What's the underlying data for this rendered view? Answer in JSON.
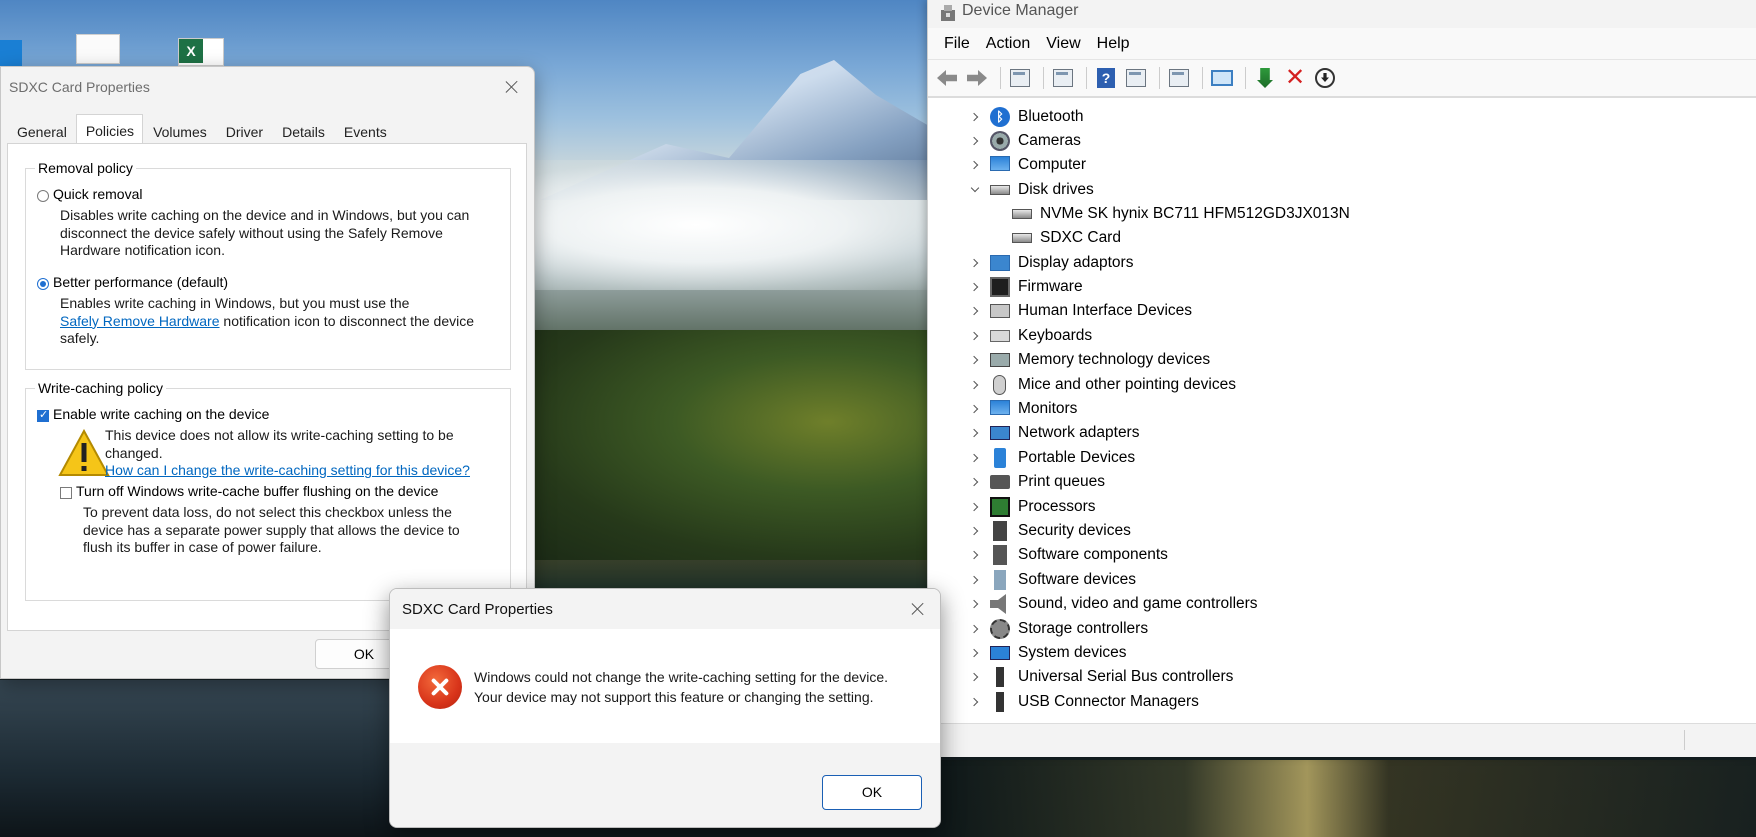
{
  "properties": {
    "title": "SDXC Card Properties",
    "tabs": [
      "General",
      "Policies",
      "Volumes",
      "Driver",
      "Details",
      "Events"
    ],
    "removal_policy": {
      "legend": "Removal policy",
      "quick_label": "Quick removal",
      "quick_desc": "Disables write caching on the device and in Windows, but you can disconnect the device safely without using the Safely Remove Hardware notification icon.",
      "better_label": "Better performance (default)",
      "better_desc_pre": "Enables write caching in Windows, but you must use the",
      "better_link": "Safely Remove Hardware",
      "better_desc_post": "notification icon to disconnect the device safely."
    },
    "write_caching": {
      "legend": "Write-caching policy",
      "enable_label": "Enable write caching on the device",
      "warning_text": "This device does not allow its write-caching setting to be changed.",
      "warning_link": "How can I change the write-caching setting for this device?",
      "flush_label": "Turn off Windows write-cache buffer flushing on the device",
      "flush_desc": "To prevent data loss, do not select this checkbox unless the device has a separate power supply that allows the device to flush its buffer in case of power failure."
    },
    "ok_label": "OK"
  },
  "device_manager": {
    "title": "Device Manager",
    "menu": [
      "File",
      "Action",
      "View",
      "Help"
    ],
    "tree": [
      {
        "label": "Bluetooth",
        "icon": "bluetooth-icon"
      },
      {
        "label": "Cameras",
        "icon": "camera-icon"
      },
      {
        "label": "Computer",
        "icon": "computer-icon"
      },
      {
        "label": "Disk drives",
        "icon": "disk-drive-icon",
        "expanded": true
      },
      {
        "label": "NVMe SK hynix BC711 HFM512GD3JX013N",
        "icon": "drive-icon",
        "child": true
      },
      {
        "label": "SDXC Card",
        "icon": "drive-icon",
        "child": true
      },
      {
        "label": "Display adaptors",
        "icon": "display-adapter-icon"
      },
      {
        "label": "Firmware",
        "icon": "firmware-icon"
      },
      {
        "label": "Human Interface Devices",
        "icon": "hid-icon"
      },
      {
        "label": "Keyboards",
        "icon": "keyboard-icon"
      },
      {
        "label": "Memory technology devices",
        "icon": "memory-icon"
      },
      {
        "label": "Mice and other pointing devices",
        "icon": "mouse-icon"
      },
      {
        "label": "Monitors",
        "icon": "monitor-icon"
      },
      {
        "label": "Network adapters",
        "icon": "network-icon"
      },
      {
        "label": "Portable Devices",
        "icon": "portable-device-icon"
      },
      {
        "label": "Print queues",
        "icon": "printer-icon"
      },
      {
        "label": "Processors",
        "icon": "processor-icon"
      },
      {
        "label": "Security devices",
        "icon": "security-device-icon"
      },
      {
        "label": "Software components",
        "icon": "software-component-icon"
      },
      {
        "label": "Software devices",
        "icon": "software-device-icon"
      },
      {
        "label": "Sound, video and game controllers",
        "icon": "sound-icon"
      },
      {
        "label": "Storage controllers",
        "icon": "storage-controller-icon"
      },
      {
        "label": "System devices",
        "icon": "system-device-icon"
      },
      {
        "label": "Universal Serial Bus controllers",
        "icon": "usb-icon"
      },
      {
        "label": "USB Connector Managers",
        "icon": "usb-icon"
      }
    ]
  },
  "error_dialog": {
    "title": "SDXC Card Properties",
    "line1": "Windows could not change the write-caching setting for the device.",
    "line2": "Your device may not support this feature or changing the setting.",
    "ok_label": "OK"
  },
  "colors": {
    "accent": "#1f6fd1",
    "link": "#0067c0",
    "error": "#d8341a"
  }
}
